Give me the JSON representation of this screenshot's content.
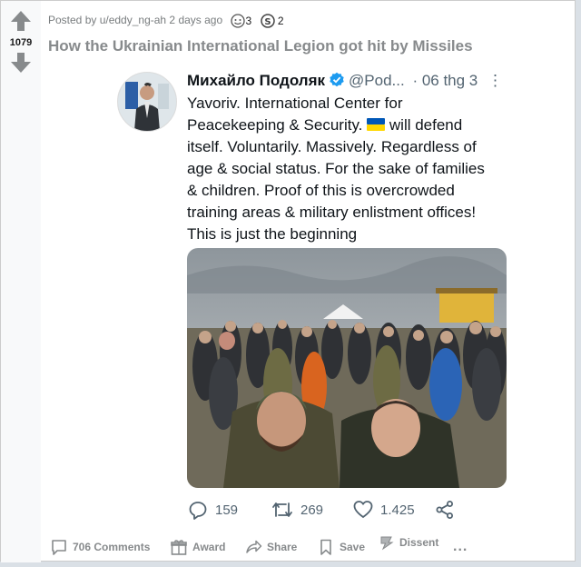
{
  "post": {
    "score": "1079",
    "meta_text": "Posted by u/eddy_ng-ah 2 days ago",
    "award_count_1": "3",
    "award_count_2": "2",
    "title": "How the Ukrainian International Legion got hit by Missiles"
  },
  "tweet": {
    "name": "Михайло Подоляк",
    "handle": "@Pod...",
    "date": "· 06 thg 3",
    "text_line1": "Yavoriv. International Center for",
    "text_line2a": "Peacekeeping & Security.",
    "text_line2b": "will defend",
    "text_line3": "itself. Voluntarily. Massively. Regardless of",
    "text_line4": "age & social status. For the sake of families",
    "text_line5": "& children. Proof of this is overcrowded",
    "text_line6": "training areas & military enlistment offices!",
    "text_line7": "This is just the beginning",
    "replies": "159",
    "retweets": "269",
    "likes": "1.425"
  },
  "actions": {
    "comments": "706 Comments",
    "award": "Award",
    "share": "Share",
    "save": "Save",
    "dissent": "Dissent",
    "more": "..."
  },
  "colors": {
    "upvote": "#878a8c",
    "verified": "#1d9bf0",
    "flag_blue": "#0057b7",
    "flag_yellow": "#ffd700"
  }
}
